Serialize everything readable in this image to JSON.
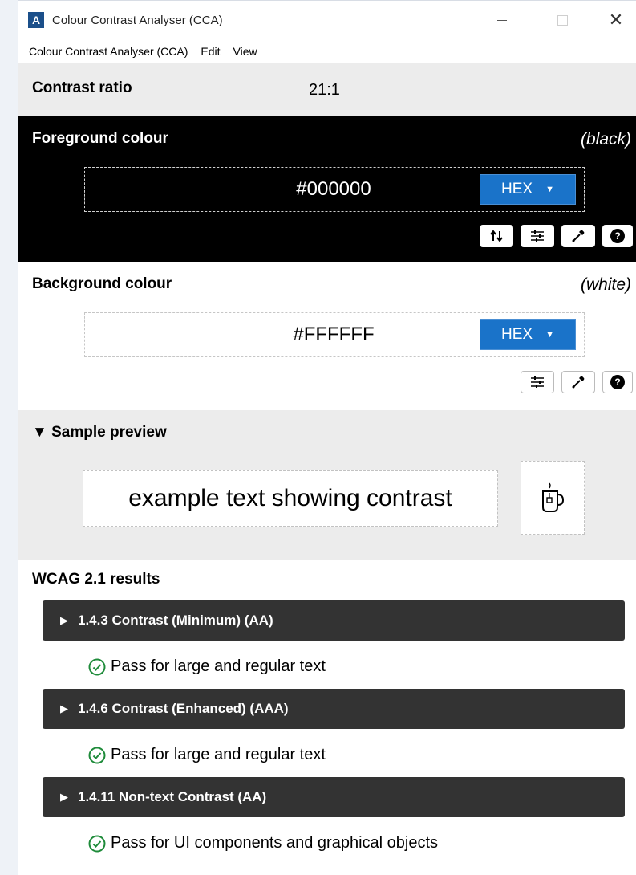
{
  "window": {
    "title": "Colour Contrast Analyser (CCA)",
    "controls": {
      "minimize": "—",
      "close": "✕"
    }
  },
  "menu": [
    "Colour Contrast Analyser (CCA)",
    "Edit",
    "View"
  ],
  "contrast": {
    "label": "Contrast ratio",
    "value": "21:1"
  },
  "foreground": {
    "title": "Foreground colour",
    "name": "(black)",
    "value": "#000000",
    "format": "HEX",
    "color": "#000000",
    "tools": [
      "swap-icon",
      "sliders-icon",
      "eyedropper-icon",
      "help-icon"
    ]
  },
  "background": {
    "title": "Background colour",
    "name": "(white)",
    "value": "#FFFFFF",
    "format": "HEX",
    "color": "#FFFFFF",
    "tools": [
      "sliders-icon",
      "eyedropper-icon",
      "help-icon"
    ]
  },
  "preview": {
    "title": "Sample preview",
    "text": "example text showing contrast",
    "toggle_glyph": "▼"
  },
  "wcag": {
    "title": "WCAG 2.1 results",
    "results": [
      {
        "criterion": "1.4.3 Contrast (Minimum) (AA)",
        "status": "Pass for large and regular text"
      },
      {
        "criterion": "1.4.6 Contrast (Enhanced) (AAA)",
        "status": "Pass for large and regular text"
      },
      {
        "criterion": "1.4.11 Non-text Contrast (AA)",
        "status": "Pass for UI components and graphical objects"
      }
    ]
  },
  "colors": {
    "accent": "#1A73C9",
    "pass": "#1E8B3A",
    "result_header": "#333333"
  }
}
